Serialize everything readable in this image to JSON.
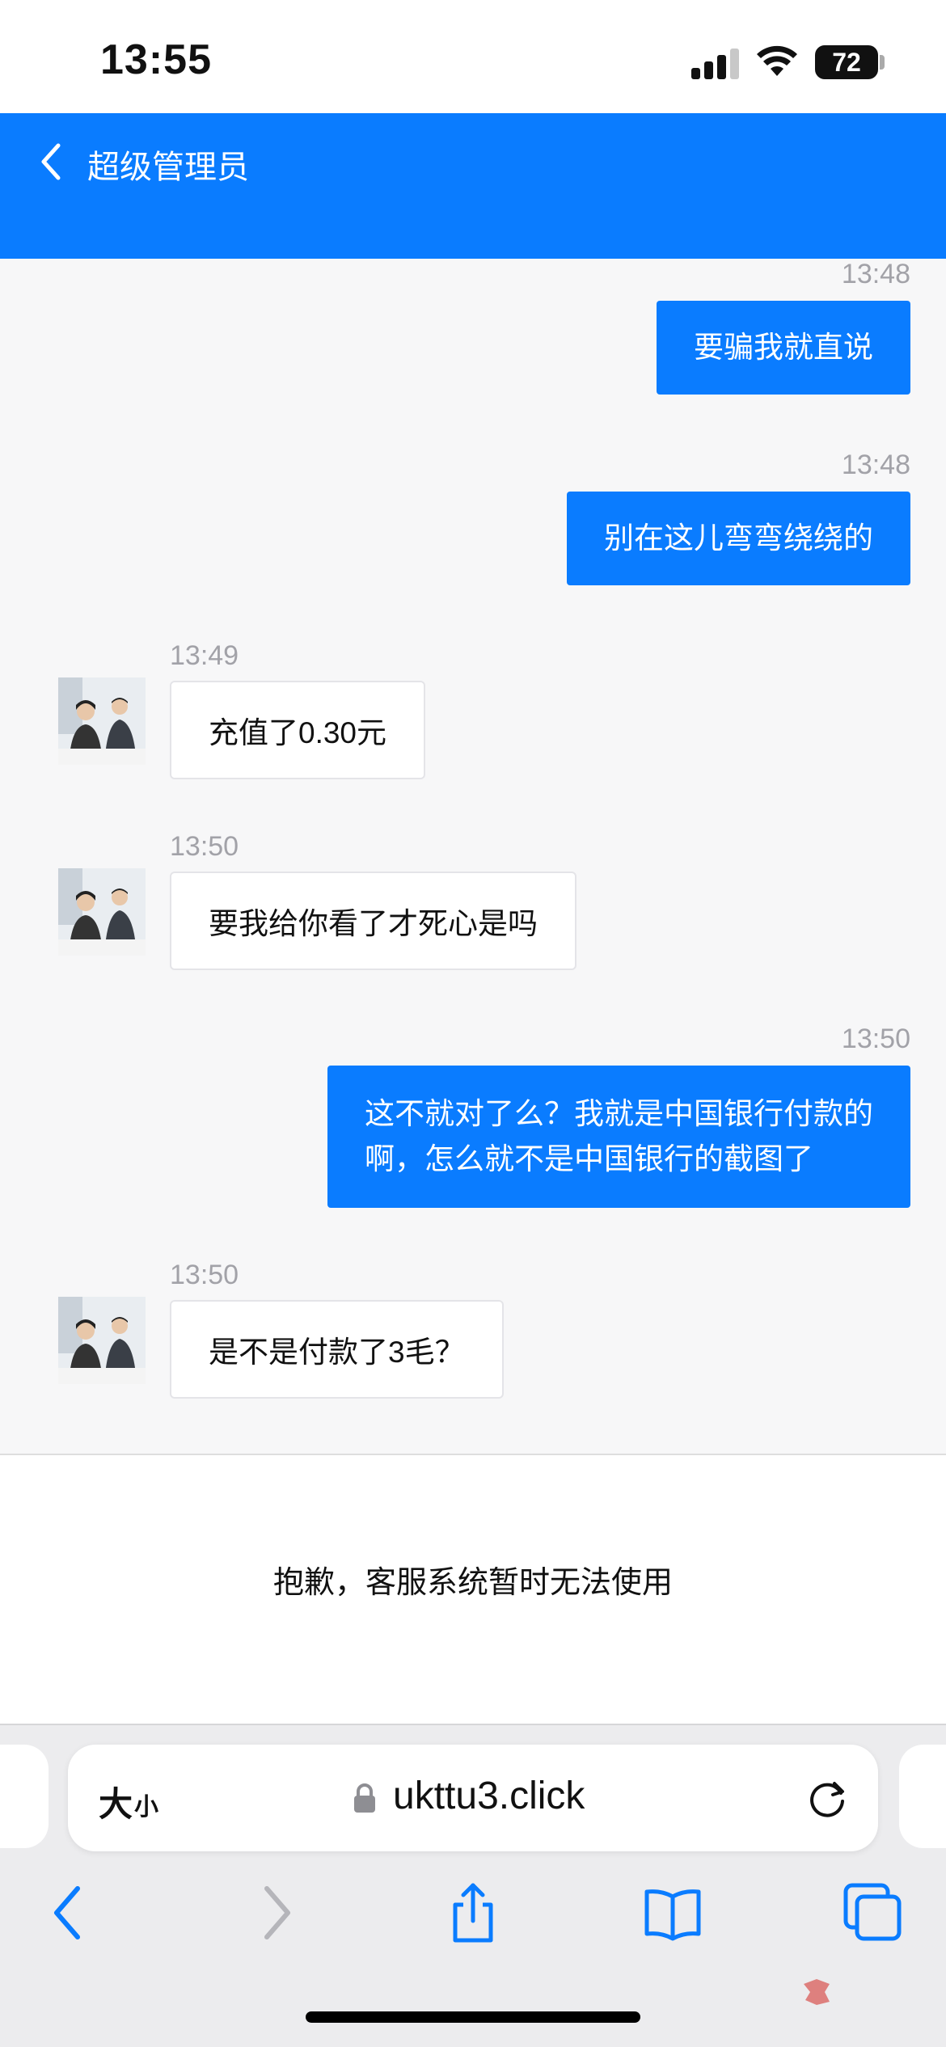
{
  "status_bar": {
    "time": "13:55",
    "battery": "72"
  },
  "header": {
    "title": "超级管理员"
  },
  "messages": [
    {
      "side": "out",
      "time": "13:48",
      "text": "要骗我就直说"
    },
    {
      "side": "out",
      "time": "13:48",
      "text": "别在这儿弯弯绕绕的"
    },
    {
      "side": "in",
      "time": "13:49",
      "text": "充值了0.30元"
    },
    {
      "side": "in",
      "time": "13:50",
      "text": "要我给你看了才死心是吗"
    },
    {
      "side": "out",
      "time": "13:50",
      "lines": [
        "这不就对了么？我就是中国银行付款的",
        "啊，怎么就不是中国银行的截图了"
      ]
    },
    {
      "side": "in",
      "time": "13:50",
      "text": "是不是付款了3毛？"
    }
  ],
  "notice": "抱歉，客服系统暂时无法使用",
  "browser": {
    "text_size_big": "大",
    "text_size_small": "小",
    "url": "ukttu3.click"
  },
  "colors": {
    "accent": "#0a7cff",
    "background": "#f7f7f8"
  },
  "icons": [
    "back-chevron-icon",
    "signal-icon",
    "wifi-icon",
    "battery-icon",
    "lock-icon",
    "reload-icon",
    "back-arrow-icon",
    "forward-arrow-icon",
    "share-icon",
    "bookmarks-icon",
    "tabs-icon"
  ]
}
